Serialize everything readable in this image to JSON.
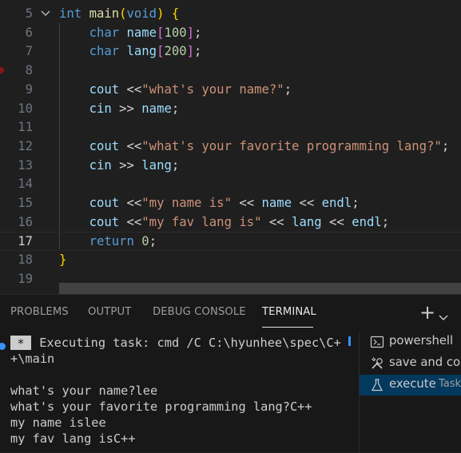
{
  "editor": {
    "lines": [
      {
        "num": "5",
        "tokens": [
          {
            "t": "int",
            "c": "kw"
          },
          {
            "t": " "
          },
          {
            "t": "main",
            "c": "fn"
          },
          {
            "t": "(",
            "c": "br1"
          },
          {
            "t": "void",
            "c": "kw"
          },
          {
            "t": ")",
            "c": "br1"
          },
          {
            "t": " "
          },
          {
            "t": "{",
            "c": "br1"
          }
        ]
      },
      {
        "num": "6",
        "tokens": [
          {
            "t": "    "
          },
          {
            "t": "char",
            "c": "kw"
          },
          {
            "t": " "
          },
          {
            "t": "name",
            "c": "var"
          },
          {
            "t": "[",
            "c": "br2"
          },
          {
            "t": "100",
            "c": "num"
          },
          {
            "t": "]",
            "c": "br2"
          },
          {
            "t": ";",
            "c": "op"
          }
        ]
      },
      {
        "num": "7",
        "tokens": [
          {
            "t": "    "
          },
          {
            "t": "char",
            "c": "kw"
          },
          {
            "t": " "
          },
          {
            "t": "lang",
            "c": "var"
          },
          {
            "t": "[",
            "c": "br2"
          },
          {
            "t": "200",
            "c": "num"
          },
          {
            "t": "]",
            "c": "br2"
          },
          {
            "t": ";",
            "c": "op"
          }
        ]
      },
      {
        "num": "8",
        "tokens": []
      },
      {
        "num": "9",
        "tokens": [
          {
            "t": "    "
          },
          {
            "t": "cout",
            "c": "var"
          },
          {
            "t": " <<",
            "c": "op"
          },
          {
            "t": "\"what's your name?\"",
            "c": "str"
          },
          {
            "t": ";",
            "c": "op"
          }
        ]
      },
      {
        "num": "10",
        "tokens": [
          {
            "t": "    "
          },
          {
            "t": "cin",
            "c": "var"
          },
          {
            "t": " >> ",
            "c": "op"
          },
          {
            "t": "name",
            "c": "var"
          },
          {
            "t": ";",
            "c": "op"
          }
        ]
      },
      {
        "num": "11",
        "tokens": []
      },
      {
        "num": "12",
        "tokens": [
          {
            "t": "    "
          },
          {
            "t": "cout",
            "c": "var"
          },
          {
            "t": " <<",
            "c": "op"
          },
          {
            "t": "\"what's your favorite programming lang?\"",
            "c": "str"
          },
          {
            "t": ";",
            "c": "op"
          }
        ]
      },
      {
        "num": "13",
        "tokens": [
          {
            "t": "    "
          },
          {
            "t": "cin",
            "c": "var"
          },
          {
            "t": " >> ",
            "c": "op"
          },
          {
            "t": "lang",
            "c": "var"
          },
          {
            "t": ";",
            "c": "op"
          }
        ]
      },
      {
        "num": "14",
        "tokens": []
      },
      {
        "num": "15",
        "tokens": [
          {
            "t": "    "
          },
          {
            "t": "cout",
            "c": "var"
          },
          {
            "t": " <<",
            "c": "op"
          },
          {
            "t": "\"my name is\"",
            "c": "str"
          },
          {
            "t": " << ",
            "c": "op"
          },
          {
            "t": "name",
            "c": "var"
          },
          {
            "t": " << ",
            "c": "op"
          },
          {
            "t": "endl",
            "c": "var"
          },
          {
            "t": ";",
            "c": "op"
          }
        ]
      },
      {
        "num": "16",
        "tokens": [
          {
            "t": "    "
          },
          {
            "t": "cout",
            "c": "var"
          },
          {
            "t": " <<",
            "c": "op"
          },
          {
            "t": "\"my fav lang is\"",
            "c": "str"
          },
          {
            "t": " << ",
            "c": "op"
          },
          {
            "t": "lang",
            "c": "var"
          },
          {
            "t": " << ",
            "c": "op"
          },
          {
            "t": "endl",
            "c": "var"
          },
          {
            "t": ";",
            "c": "op"
          }
        ]
      },
      {
        "num": "17",
        "active": true,
        "tokens": [
          {
            "t": "    "
          },
          {
            "t": "return",
            "c": "kw"
          },
          {
            "t": " "
          },
          {
            "t": "0",
            "c": "num"
          },
          {
            "t": ";",
            "c": "op"
          }
        ]
      },
      {
        "num": "18",
        "tokens": [
          {
            "t": "}",
            "c": "br1"
          }
        ]
      },
      {
        "num": "19",
        "tokens": []
      }
    ]
  },
  "panel": {
    "tabs": {
      "problems": "PROBLEMS",
      "output": "OUTPUT",
      "debug_console": "DEBUG CONSOLE",
      "terminal": "TERMINAL"
    },
    "add_label": "+"
  },
  "terminal": {
    "badge": "*",
    "task_line": " Executing task: cmd /C C:\\hyunhee\\spec\\C+",
    "task_line2": "+\\main",
    "output": [
      "what's your name?lee",
      "what's your favorite programming lang?C++",
      "my name islee",
      "my fav lang isC++"
    ]
  },
  "terminal_list": {
    "items": [
      {
        "label": "powershell",
        "icon": "terminal-powershell-icon"
      },
      {
        "label": "save and compile",
        "icon": "tools-icon"
      },
      {
        "label": "execute",
        "sublabel": "Task",
        "icon": "beaker-icon",
        "selected": true
      }
    ]
  },
  "colors": {
    "background": "#1f1f1f",
    "keyword": "#569cd6",
    "function": "#dcdcaa",
    "variable": "#9cdcfe",
    "string": "#ce9178",
    "number": "#b5cea8",
    "accent": "#3794ff"
  }
}
